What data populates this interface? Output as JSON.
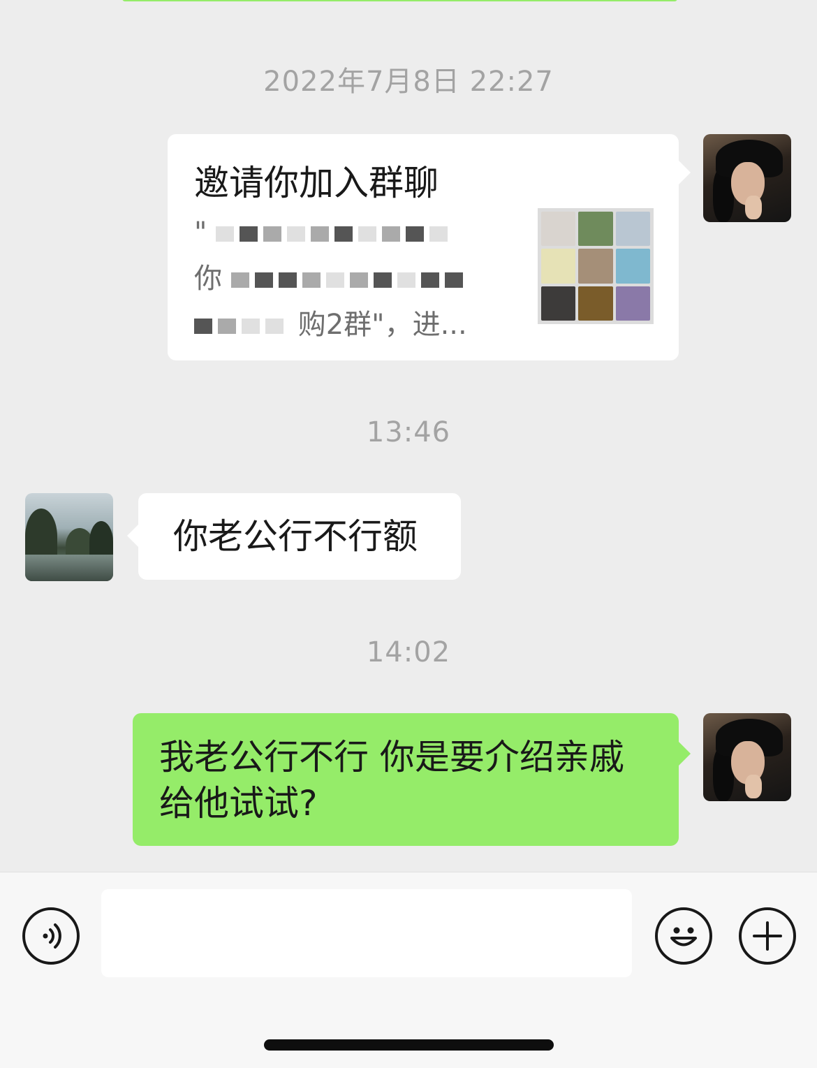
{
  "timestamps": {
    "first": "2022年7月8日 22:27",
    "second": "13:46",
    "third": "14:02"
  },
  "invite_card": {
    "title": "邀请你加入群聊",
    "desc_line1_visible": "\"",
    "desc_line2_visible": "你",
    "desc_line3_visible": "购2群\"，进..."
  },
  "messages": {
    "incoming_1": "你老公行不行额",
    "outgoing_1": "我老公行不行 你是要介绍亲戚给他试试?"
  },
  "icons": {
    "voice": "voice-icon",
    "emoji": "emoji-icon",
    "plus": "plus-icon"
  },
  "colors": {
    "background": "#ededed",
    "green_bubble": "#95ec69",
    "white_bubble": "#ffffff",
    "timestamp_text": "#a3a3a3"
  }
}
